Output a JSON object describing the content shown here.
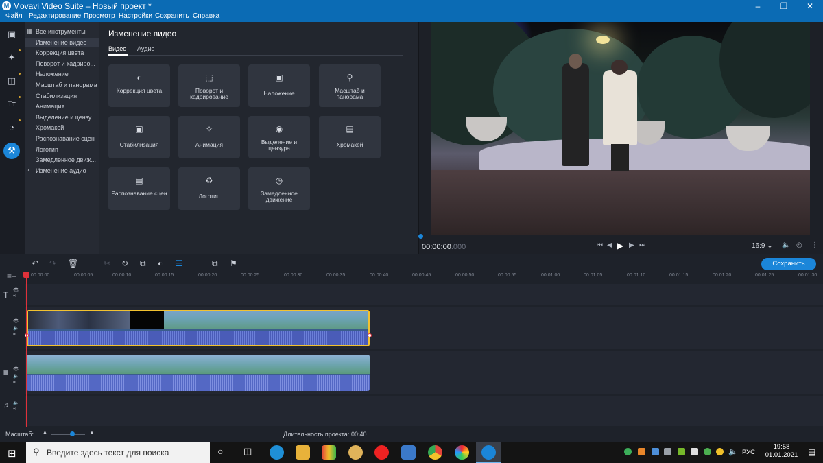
{
  "window": {
    "title": "Movavi Video Suite – Новый проект *",
    "app_icon": "Movavi"
  },
  "menu": [
    "Файл",
    "Редактирование",
    "Просмотр",
    "Настройки",
    "Сохранить",
    "Справка"
  ],
  "tools": {
    "items": [
      {
        "label": "Все инструменты"
      },
      {
        "label": "Изменение видео"
      },
      {
        "label": "Коррекция цвета"
      },
      {
        "label": "Поворот и кадриро..."
      },
      {
        "label": "Наложение"
      },
      {
        "label": "Масштаб и панорама"
      },
      {
        "label": "Стабилизация"
      },
      {
        "label": "Анимация"
      },
      {
        "label": "Выделение и цензу..."
      },
      {
        "label": "Хромакей"
      },
      {
        "label": "Распознавание сцен"
      },
      {
        "label": "Логотип"
      },
      {
        "label": "Замедленное движ..."
      },
      {
        "label": "Изменение аудио"
      }
    ]
  },
  "panel": {
    "title": "Изменение видео",
    "tabs": [
      "Видео",
      "Аудио"
    ],
    "cards": [
      {
        "label": "Коррекция цвета",
        "icon": "color-correction-icon"
      },
      {
        "label": "Поворот и кадрирование",
        "icon": "crop-icon"
      },
      {
        "label": "Наложение",
        "icon": "overlay-icon"
      },
      {
        "label": "Масштаб и панорама",
        "icon": "zoom-pan-icon"
      },
      {
        "label": "Стабилизация",
        "icon": "stabilization-icon"
      },
      {
        "label": "Анимация",
        "icon": "animation-icon"
      },
      {
        "label": "Выделение и цензура",
        "icon": "censor-icon"
      },
      {
        "label": "Хромакей",
        "icon": "chromakey-icon"
      },
      {
        "label": "Распознавание сцен",
        "icon": "scene-detect-icon"
      },
      {
        "label": "Логотип",
        "icon": "logo-icon"
      },
      {
        "label": "Замедленное движение",
        "icon": "slow-motion-icon"
      }
    ]
  },
  "preview": {
    "time": "00:00:00",
    "time_ms": ".000",
    "aspect": "16:9"
  },
  "toolbar": {
    "save_label": "Сохранить"
  },
  "ruler": [
    "00:00:00",
    "00:00:05",
    "00:00:10",
    "00:00:15",
    "00:00:20",
    "00:00:25",
    "00:00:30",
    "00:00:35",
    "00:00:40",
    "00:00:45",
    "00:00:50",
    "00:00:55",
    "00:01:00",
    "00:01:05",
    "00:01:10",
    "00:01:15",
    "00:01:20",
    "00:01:25",
    "00:01:30"
  ],
  "bottom": {
    "scale_label": "Масштаб:",
    "duration_label": "Длительность проекта:",
    "duration_value": "00:40"
  },
  "taskbar": {
    "search_placeholder": "Введите здесь текст для поиска",
    "time": "19:58",
    "date": "01.01.2021",
    "lang": "РУС"
  },
  "colors": {
    "accent": "#1b86d9",
    "titlebar": "#0b6bb4",
    "selection": "#f2c230",
    "playhead": "#e0313a"
  }
}
